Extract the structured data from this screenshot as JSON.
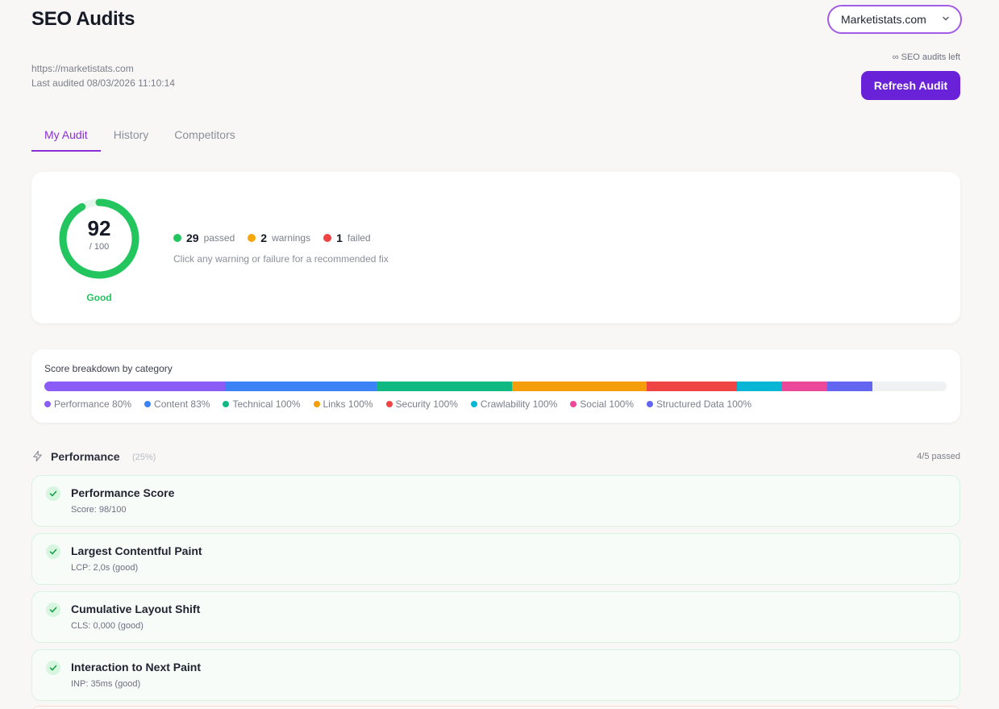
{
  "header": {
    "title": "SEO Audits",
    "site_selector": "Marketistats.com",
    "url": "https://marketistats.com",
    "last_audited": "Last audited 08/03/2026 11:10:14",
    "audits_left": "∞ SEO audits left",
    "refresh_label": "Refresh Audit"
  },
  "tabs": [
    {
      "label": "My Audit",
      "active": true
    },
    {
      "label": "History",
      "active": false
    },
    {
      "label": "Competitors",
      "active": false
    }
  ],
  "score": {
    "value": "92",
    "denominator": "/ 100",
    "fraction": 0.92,
    "rating": "Good",
    "color": "#22c55e"
  },
  "stats": {
    "passed": {
      "count": "29",
      "label": "passed",
      "color": "#22c55e"
    },
    "warnings": {
      "count": "2",
      "label": "warnings",
      "color": "#f5a60b"
    },
    "failed": {
      "count": "1",
      "label": "failed",
      "color": "#ef4444"
    },
    "hint": "Click any warning or failure for a recommended fix"
  },
  "breakdown": {
    "title": "Score breakdown by category",
    "categories": [
      {
        "label": "Performance 80%",
        "color": "#8b5cf6",
        "share": 20
      },
      {
        "label": "Content 83%",
        "color": "#3b82f6",
        "share": 16.8
      },
      {
        "label": "Technical 100%",
        "color": "#10b981",
        "share": 15
      },
      {
        "label": "Links 100%",
        "color": "#f59e0b",
        "share": 15
      },
      {
        "label": "Security 100%",
        "color": "#ef4444",
        "share": 10
      },
      {
        "label": "Crawlability 100%",
        "color": "#06b6d4",
        "share": 5
      },
      {
        "label": "Social 100%",
        "color": "#ec4899",
        "share": 5
      },
      {
        "label": "Structured Data 100%",
        "color": "#6366f1",
        "share": 5
      }
    ]
  },
  "section": {
    "title": "Performance",
    "weight": "(25%)",
    "count": "4/5 passed",
    "checks": [
      {
        "title": "Performance Score",
        "detail": "Score: 98/100"
      },
      {
        "title": "Largest Contentful Paint",
        "detail": "LCP: 2,0s (good)"
      },
      {
        "title": "Cumulative Layout Shift",
        "detail": "CLS: 0,000 (good)"
      },
      {
        "title": "Interaction to Next Paint",
        "detail": "INP: 35ms (good)"
      }
    ]
  }
}
